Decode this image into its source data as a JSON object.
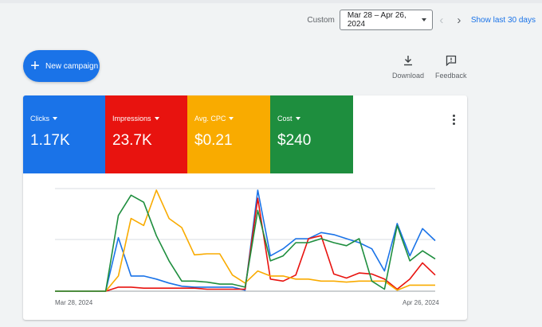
{
  "header": {
    "custom_label": "Custom",
    "date_range": "Mar 28 – Apr 26, 2024",
    "prev_icon": "chevron-left",
    "next_icon": "chevron-right",
    "show_last": "Show last 30 days"
  },
  "actions": {
    "new_campaign": "New campaign",
    "download": "Download",
    "feedback": "Feedback"
  },
  "metrics": [
    {
      "label": "Clicks",
      "value": "1.17K",
      "color": "#1a73e8"
    },
    {
      "label": "Impressions",
      "value": "23.7K",
      "color": "#e8130f"
    },
    {
      "label": "Avg. CPC",
      "value": "$0.21",
      "color": "#f9ab00"
    },
    {
      "label": "Cost",
      "value": "$240",
      "color": "#1e8e3e"
    }
  ],
  "chart_data": {
    "type": "line",
    "x_labels": [
      "Mar 28, 2024",
      "Apr 26, 2024"
    ],
    "days": 30,
    "grid": true,
    "series": [
      {
        "metric": "Clicks",
        "color": "#1a73e8",
        "values": [
          0,
          0,
          0,
          0,
          0,
          53,
          15,
          15,
          12,
          8,
          5,
          4,
          4,
          4,
          4,
          1,
          100,
          35,
          42,
          52,
          52,
          58,
          56,
          52,
          48,
          42,
          20,
          67,
          35,
          62,
          50
        ]
      },
      {
        "metric": "Impressions",
        "color": "#e8130f",
        "values": [
          0,
          0,
          0,
          0,
          0,
          4,
          4,
          3,
          3,
          3,
          3,
          3,
          2,
          2,
          2,
          2,
          92,
          12,
          10,
          16,
          52,
          55,
          17,
          13,
          18,
          17,
          12,
          2,
          12,
          28,
          16
        ]
      },
      {
        "metric": "Avg. CPC",
        "color": "#f9ab00",
        "values": [
          0,
          0,
          0,
          0,
          0,
          15,
          72,
          65,
          100,
          72,
          63,
          36,
          37,
          37,
          16,
          8,
          20,
          15,
          15,
          12,
          12,
          10,
          10,
          9,
          10,
          10,
          10,
          1,
          6,
          6,
          6
        ]
      },
      {
        "metric": "Cost",
        "color": "#1e8e3e",
        "values": [
          0,
          0,
          0,
          0,
          0,
          75,
          95,
          88,
          55,
          30,
          10,
          10,
          9,
          7,
          7,
          4,
          80,
          30,
          35,
          48,
          48,
          52,
          48,
          45,
          52,
          10,
          2,
          65,
          30,
          40,
          32
        ]
      }
    ]
  }
}
